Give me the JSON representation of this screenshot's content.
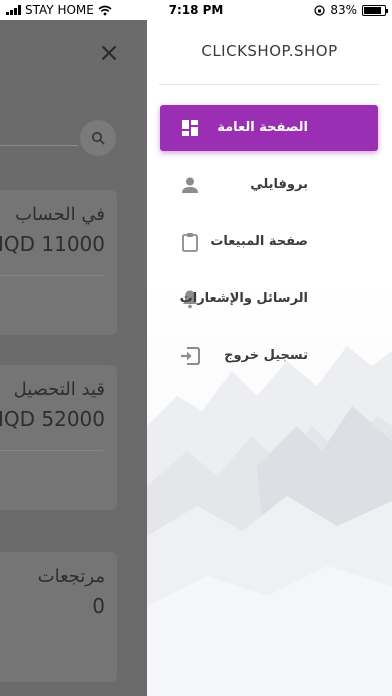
{
  "status_bar": {
    "carrier": "STAY HOME",
    "time": "7:18 PM",
    "battery": "83%",
    "battery_level": 0.83
  },
  "background": {
    "cards": [
      {
        "label": "في الحساب",
        "value": "11000 IQD"
      },
      {
        "label": "قيد التحصيل",
        "value": "52000 IQD"
      },
      {
        "label": "مرتجعات",
        "value": "0"
      }
    ]
  },
  "drawer": {
    "brand": "CLICKSHOP.SHOP",
    "menu": [
      {
        "label": "الصفحة العامة",
        "icon": "dashboard-icon",
        "active": true
      },
      {
        "label": "بروفايلي",
        "icon": "person-icon",
        "active": false
      },
      {
        "label": "صفحة المبيعات",
        "icon": "clipboard-icon",
        "active": false
      },
      {
        "label": "الرسائل والإشعارات",
        "icon": "bell-icon",
        "active": false
      },
      {
        "label": "تسجيل خروج",
        "icon": "logout-icon",
        "active": false
      }
    ]
  },
  "colors": {
    "accent": "#9b2fb3",
    "icon_gray": "#8c8c8c",
    "overlay": "#6b6b6b"
  }
}
